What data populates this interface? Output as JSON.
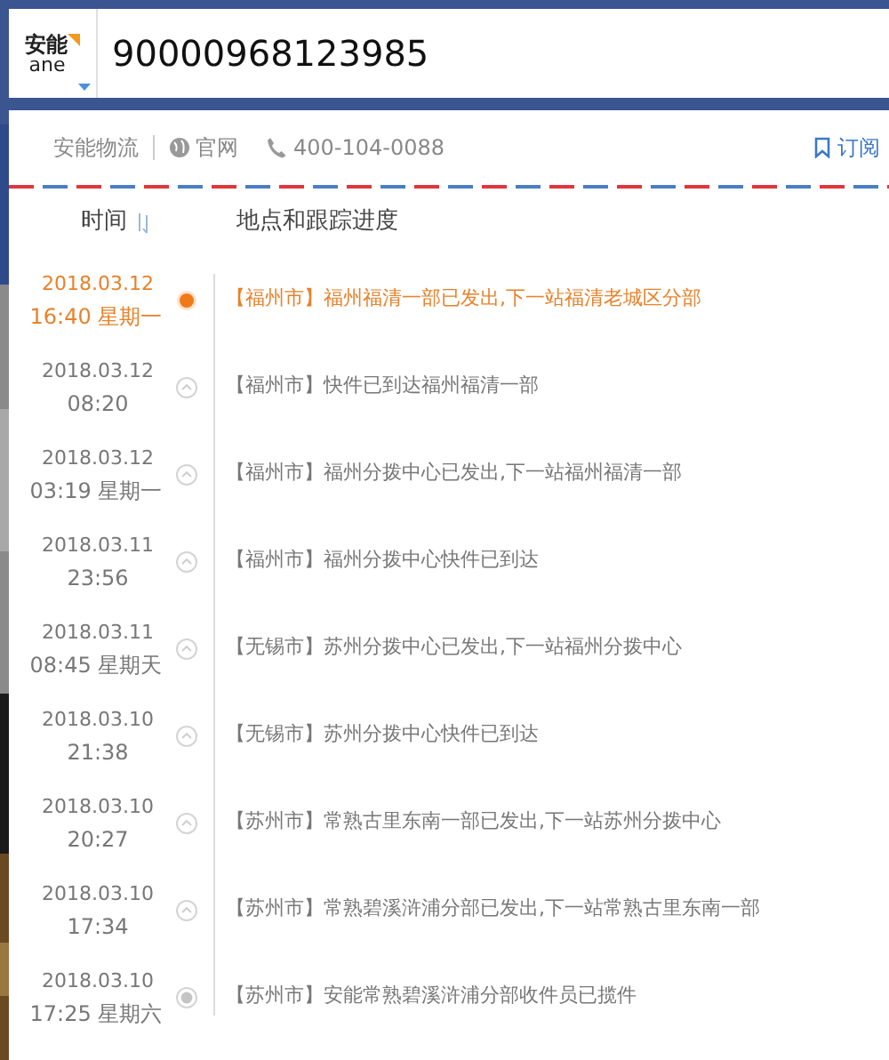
{
  "search": {
    "logo_top": "安能",
    "logo_bottom": "ane",
    "value": "90000968123985"
  },
  "info": {
    "company": "安能物流",
    "website": "官网",
    "phone": "400-104-0088",
    "subscribe": "订阅"
  },
  "columns": {
    "time": "时间",
    "progress": "地点和跟踪进度"
  },
  "events": [
    {
      "kind": "current",
      "date": "2018.03.12",
      "time": "16:40",
      "weekday": "星期一",
      "city": "【福州市】",
      "text": "福州福清一部已发出,下一站福清老城区分部"
    },
    {
      "kind": "transit",
      "date": "2018.03.12",
      "time": "08:20",
      "city": "【福州市】",
      "text": "快件已到达福州福清一部"
    },
    {
      "kind": "transit",
      "date": "2018.03.12",
      "time": "03:19",
      "weekday": "星期一",
      "city": "【福州市】",
      "text": "福州分拨中心已发出,下一站福州福清一部"
    },
    {
      "kind": "transit",
      "date": "2018.03.11",
      "time": "23:56",
      "city": "【福州市】",
      "text": "福州分拨中心快件已到达"
    },
    {
      "kind": "transit",
      "date": "2018.03.11",
      "time": "08:45",
      "weekday": "星期天",
      "city": "【无锡市】",
      "text": "苏州分拨中心已发出,下一站福州分拨中心"
    },
    {
      "kind": "transit",
      "date": "2018.03.10",
      "time": "21:38",
      "city": "【无锡市】",
      "text": "苏州分拨中心快件已到达"
    },
    {
      "kind": "transit",
      "date": "2018.03.10",
      "time": "20:27",
      "city": "【苏州市】",
      "text": "常熟古里东南一部已发出,下一站苏州分拨中心"
    },
    {
      "kind": "transit",
      "date": "2018.03.10",
      "time": "17:34",
      "city": "【苏州市】",
      "text": "常熟碧溪浒浦分部已发出,下一站常熟古里东南一部"
    },
    {
      "kind": "origin",
      "date": "2018.03.10",
      "time": "17:25",
      "weekday": "星期六",
      "city": "【苏州市】",
      "text": "安能常熟碧溪浒浦分部收件员已揽件"
    }
  ]
}
